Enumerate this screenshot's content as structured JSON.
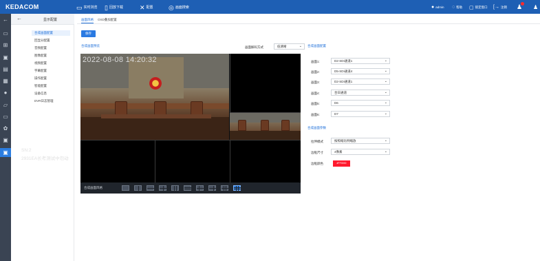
{
  "app": {
    "logo": "KEDACOM",
    "nav": [
      {
        "icon": "monitor-icon",
        "label": "实时浏览"
      },
      {
        "icon": "file-icon",
        "label": "回放下载"
      },
      {
        "icon": "wrench-icon",
        "label": "配置"
      },
      {
        "icon": "search-icon",
        "label": "画面搜索"
      }
    ],
    "user": "admin",
    "right_links": [
      "帮助",
      "锁定窗口",
      "注销"
    ],
    "notification_count": ""
  },
  "menu": {
    "back_icon": "arrow-left-icon",
    "title": "显示配置",
    "items": [
      {
        "label": "合成画面配置",
        "active": true
      },
      {
        "label": "回显分配置",
        "active": false
      },
      {
        "label": "音频配置",
        "active": false
      },
      {
        "label": "图像配置",
        "active": false
      },
      {
        "label": "视频配置",
        "active": false
      },
      {
        "label": "字幕配置",
        "active": false
      },
      {
        "label": "操作配置",
        "active": false
      },
      {
        "label": "智能配置",
        "active": false
      },
      {
        "label": "设备信息",
        "active": false
      },
      {
        "label": "DVR日志管理",
        "active": false
      }
    ],
    "rail_icons": [
      "monitor-icon",
      "grid-icon",
      "camera-icon",
      "film-icon",
      "database-icon",
      "globe-icon",
      "folder-icon",
      "card-icon",
      "gear-icon",
      "screen-icon",
      "display-icon"
    ]
  },
  "tabs": [
    {
      "label": "画面风格",
      "active": true
    },
    {
      "label": "OSD叠加配置",
      "active": false
    }
  ],
  "toolbar": {
    "save_label": "保存"
  },
  "preview": {
    "section_title": "合成画面预览",
    "decode_label": "画面解码方式",
    "decode_value": "低清晰",
    "osd_time": "2022-08-08 14:20:32",
    "osd_sn": "SN:2",
    "osd_text": "2931EA长考测试中勿动",
    "layout_label": "合成画面风格",
    "layout_count": 11,
    "layout_active_index": 10
  },
  "config": {
    "section_title": "合成画面配置",
    "channels": [
      {
        "label": "画面1:",
        "value": "D2-SDI通道1"
      },
      {
        "label": "画面2:",
        "value": "D5-SDI通道4"
      },
      {
        "label": "画面3:",
        "value": "D2-SDI通道1"
      },
      {
        "label": "画面4:",
        "value": "合日通道"
      },
      {
        "label": "画面5:",
        "value": "D6"
      },
      {
        "label": "画面6:",
        "value": "D7"
      }
    ]
  },
  "params": {
    "section_title": "合成画面参数",
    "rows": [
      {
        "label": "拉伸模式",
        "value": "按照缩比例缩放",
        "type": "select"
      },
      {
        "label": "边框尺寸",
        "value": "4像素",
        "type": "select"
      },
      {
        "label": "边框颜色",
        "value": "#FF0000",
        "type": "color"
      }
    ]
  }
}
